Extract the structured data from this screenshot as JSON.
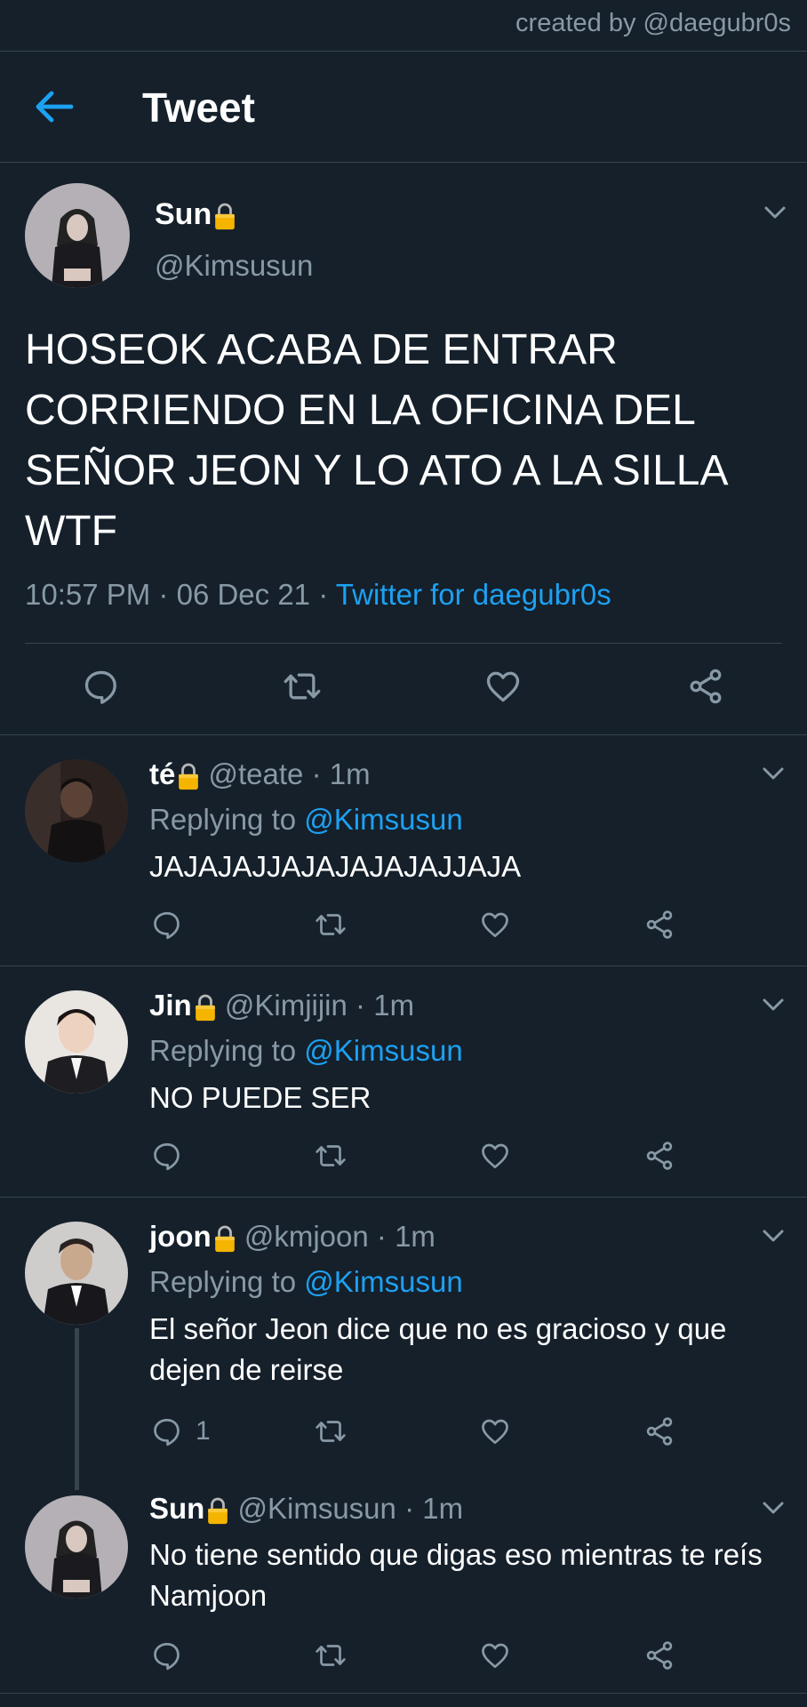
{
  "credit": "created by @daegubr0s",
  "header": {
    "title": "Tweet"
  },
  "main_tweet": {
    "name": "Sun",
    "handle": "@Kimsusun",
    "text": "HOSEOK ACABA DE ENTRAR CORRIENDO EN LA OFICINA DEL SEÑOR JEON Y LO ATO A LA SILLA WTF",
    "time": "10:57 PM",
    "date": "06 Dec 21",
    "sep": "·",
    "source": "Twitter for daegubr0s"
  },
  "replying_label": "Replying to",
  "replies": [
    {
      "name": "té",
      "handle": "@teate",
      "time": "1m",
      "reply_to": "@Kimsusun",
      "text": "JAJAJAJJAJAJAJAJAJJAJA",
      "reply_count": ""
    },
    {
      "name": "Jin",
      "handle": "@Kimjijin",
      "time": "1m",
      "reply_to": "@Kimsusun",
      "text": "NO PUEDE SER",
      "reply_count": ""
    },
    {
      "name": "joon",
      "handle": "@kmjoon",
      "time": "1m",
      "reply_to": "@Kimsusun",
      "text": "El señor Jeon dice que no es gracioso y que dejen de reirse",
      "reply_count": "1"
    },
    {
      "name": "Sun",
      "handle": "@Kimsusun",
      "time": "1m",
      "text": "No tiene sentido que digas eso mientras te reís Namjoon",
      "reply_count": ""
    }
  ],
  "colors": {
    "background": "#15202b",
    "accent": "#1da1f2",
    "muted": "#8899a6",
    "divider": "#38444d",
    "lock": "#f4b400"
  },
  "icons": [
    "arrow-left-icon",
    "lock-icon",
    "chevron-down-icon",
    "reply-icon",
    "retweet-icon",
    "like-icon",
    "share-icon"
  ]
}
